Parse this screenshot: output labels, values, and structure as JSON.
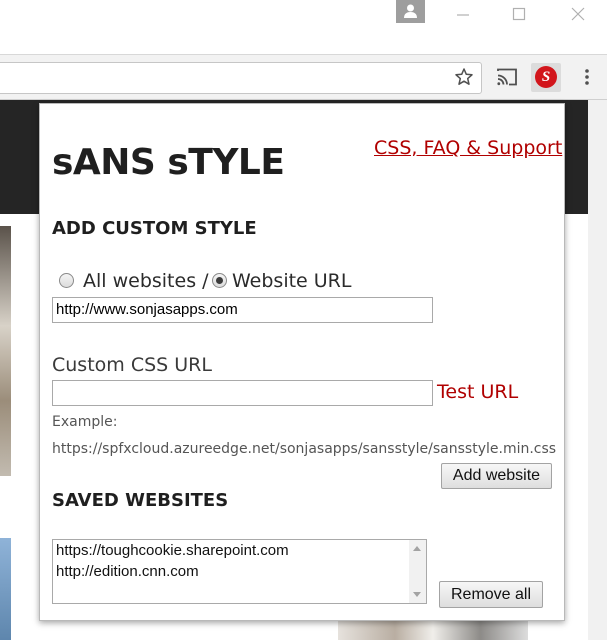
{
  "browser": {
    "icons": {
      "profile": "profile-icon",
      "minimize": "minimize-icon",
      "maximize": "maximize-icon",
      "close": "close-icon",
      "bookmark": "star-icon",
      "cast": "cast-icon",
      "extension": "sans-style-extension-icon",
      "menu": "kebab-menu-icon"
    },
    "extension_logo_letter": "S",
    "extension_color": "#d2151b"
  },
  "popup": {
    "title": "sANS sTYLE",
    "support_link": "CSS, FAQ & Support",
    "add_section": {
      "heading": "ADD CUSTOM STYLE",
      "radio_all_label": "All websites /",
      "radio_url_label": "Website URL",
      "selected": "Website URL",
      "website_url_value": "http://www.sonjasapps.com",
      "css_label": "Custom CSS URL",
      "css_value": "",
      "test_link": "Test URL",
      "example_label": "Example:",
      "example_value": "https://spfxcloud.azureedge.net/sonjasapps/sansstyle/sansstyle.min.css",
      "add_button": "Add website"
    },
    "saved_section": {
      "heading": "SAVED WEBSITES",
      "items": [
        "https://toughcookie.sharepoint.com",
        "http://edition.cnn.com"
      ],
      "remove_button": "Remove all"
    },
    "link_color": "#b00000"
  }
}
